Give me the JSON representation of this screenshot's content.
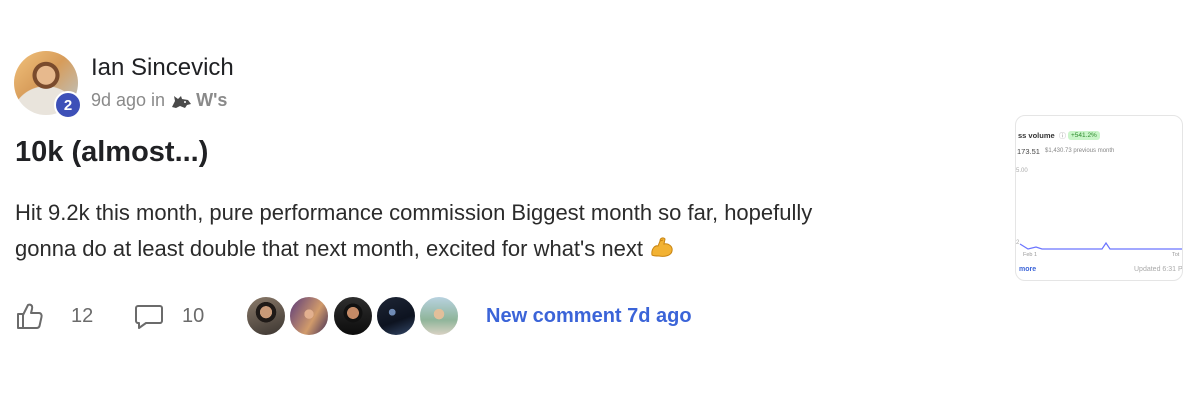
{
  "post": {
    "author": {
      "name": "Ian Sincevich",
      "level": "2"
    },
    "meta": {
      "time": "9d ago in",
      "group": "W's"
    },
    "title": "10k (almost...)",
    "body_line1": "Hit 9.2k this month, pure performance commission Biggest month so far, hopefully",
    "body_line2": "gonna do at least double that next month, excited for what's next",
    "likes": "12",
    "comments": "10",
    "new_comment": "New comment 7d ago",
    "commenter_count": 5
  },
  "thumbnail": {
    "label": "ss volume",
    "badge": "+541.2%",
    "value": "173.51",
    "previous": "$1,430.73 previous month",
    "ytick_top": "5.00",
    "ytick_bottom": "2",
    "x_start": "Feb 1",
    "x_end": "Tot",
    "more": "more",
    "updated": "Updated 6:31 P"
  },
  "colors": {
    "accent": "#3b64d8",
    "badge": "#3d50b8",
    "chart_line": "#6b74ff"
  }
}
